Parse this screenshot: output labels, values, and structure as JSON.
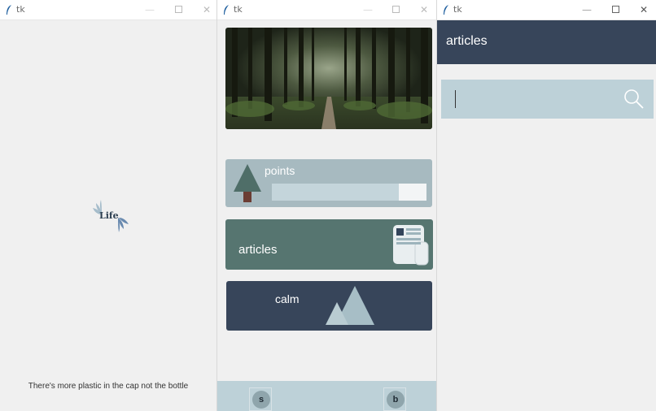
{
  "windows": [
    {
      "title": "tk"
    },
    {
      "title": "tk"
    },
    {
      "title": "tk"
    }
  ],
  "titlebar_controls": {
    "minimize": "—",
    "close": "✕"
  },
  "splash": {
    "logo_text": "Life",
    "fact": "There's more plastic in the cap not the bottle"
  },
  "dashboard": {
    "points": {
      "label": "points",
      "progress": 0.82
    },
    "articles": {
      "label": "articles"
    },
    "calm": {
      "label": "calm"
    },
    "bottom_nav": {
      "left": "s",
      "right": "b"
    }
  },
  "articles_page": {
    "header_title": "articles",
    "search": {
      "value": "",
      "placeholder": ""
    }
  },
  "colors": {
    "navy": "#37455a",
    "teal": "#567570",
    "slate_blue": "#a7bac0",
    "light_blue": "#bdd1d8"
  },
  "icons": [
    "feather-icon",
    "tree-icon",
    "newspaper-icon",
    "mountain-icon",
    "search-icon"
  ]
}
